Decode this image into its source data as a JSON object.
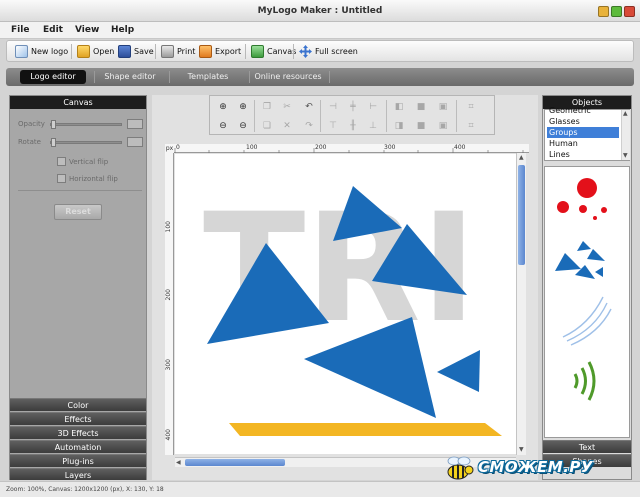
{
  "window": {
    "title": "MyLogo Maker : Untitled"
  },
  "menu": [
    "File",
    "Edit",
    "View",
    "Help"
  ],
  "toolbar": {
    "new_logo": "New logo",
    "open": "Open",
    "save": "Save",
    "print": "Print",
    "export": "Export",
    "canvas": "Canvas",
    "full_screen": "Full screen"
  },
  "tabs": [
    "Logo editor",
    "Shape editor",
    "Templates",
    "Online resources"
  ],
  "left_panel": {
    "header": "Canvas",
    "opacity_label": "Opacity",
    "rotate_label": "Rotate",
    "vertical_flip": "Vertical flip",
    "horizontal_flip": "Horizontal flip",
    "reset": "Reset",
    "sections": [
      "Color",
      "Effects",
      "3D Effects",
      "Automation",
      "Plug-ins",
      "Layers"
    ]
  },
  "canvas": {
    "ruler_unit": "px",
    "h_ticks": [
      "0",
      "100",
      "200",
      "300",
      "400"
    ],
    "v_ticks": [
      "100",
      "200",
      "300",
      "400"
    ],
    "bg_text": "TRI",
    "colors": {
      "triangle": "#1a6bb8",
      "bar": "#f3b623",
      "bg_text": "#d6d6d6"
    }
  },
  "right_panel": {
    "header": "Objects",
    "objects": [
      "Geometric",
      "Glasses",
      "Groups",
      "Human",
      "Lines"
    ],
    "selected": "Groups",
    "sections": [
      "Text",
      "Shapes"
    ]
  },
  "status": {
    "text": "Zoom: 100%, Canvas: 1200x1200 (px), X: 130, Y: 18"
  },
  "watermark": {
    "text": "СМОЖЕМ.РУ"
  }
}
